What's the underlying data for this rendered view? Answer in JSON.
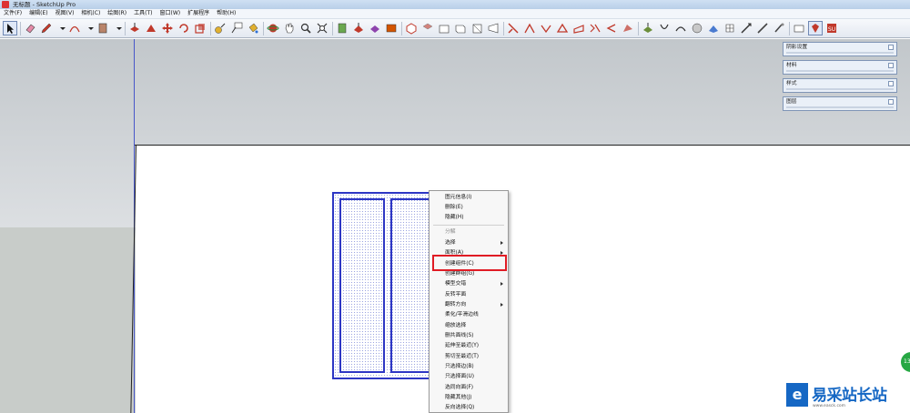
{
  "window": {
    "title": "无标题 - SketchUp Pro"
  },
  "menubar": {
    "items": [
      "文件(F)",
      "编辑(E)",
      "视图(V)",
      "相机(C)",
      "绘图(R)",
      "工具(T)",
      "窗口(W)",
      "扩展程序",
      "帮助(H)"
    ]
  },
  "panels": [
    {
      "label": "阴影设置"
    },
    {
      "label": "材料"
    },
    {
      "label": "样式"
    },
    {
      "label": "图层"
    }
  ],
  "context_menu": {
    "items": [
      {
        "label": "图元信息(I)",
        "dim": false,
        "submenu": false
      },
      {
        "label": "删除(E)",
        "dim": false,
        "submenu": false
      },
      {
        "label": "隐藏(H)",
        "dim": false,
        "submenu": false
      },
      {
        "label": "分解",
        "dim": true,
        "submenu": false
      },
      {
        "label": "选择",
        "dim": false,
        "submenu": true
      },
      {
        "label": "面积(A)",
        "dim": false,
        "submenu": true
      },
      {
        "label": "创建组件(C)",
        "dim": false,
        "submenu": false
      },
      {
        "label": "创建群组(G)",
        "dim": false,
        "submenu": false
      },
      {
        "label": "模型交错",
        "dim": false,
        "submenu": true
      },
      {
        "label": "反转平面",
        "dim": false,
        "submenu": false
      },
      {
        "label": "翻转方向",
        "dim": false,
        "submenu": true
      },
      {
        "label": "柔化/平滑边线",
        "dim": false,
        "submenu": false
      },
      {
        "label": "缩放选择",
        "dim": false,
        "submenu": false
      },
      {
        "label": "删共面线(S)",
        "dim": false,
        "submenu": false
      },
      {
        "label": "延伸至最近(Y)",
        "dim": false,
        "submenu": false
      },
      {
        "label": "剪切至最近(T)",
        "dim": false,
        "submenu": false
      },
      {
        "label": "只选择边(B)",
        "dim": false,
        "submenu": false
      },
      {
        "label": "只选择面(U)",
        "dim": false,
        "submenu": false
      },
      {
        "label": "选同向面(F)",
        "dim": false,
        "submenu": false
      },
      {
        "label": "隐藏其他(J)",
        "dim": false,
        "submenu": false
      },
      {
        "label": "反向选择(Q)",
        "dim": false,
        "submenu": false
      }
    ]
  },
  "watermark": {
    "badge": "13",
    "logo_glyph": "e",
    "name": "易采站长站",
    "url": "www.easck.com"
  },
  "colors": {
    "accent": "#2d36c4",
    "highlight": "#e01b24",
    "watermark": "#1567c4"
  }
}
